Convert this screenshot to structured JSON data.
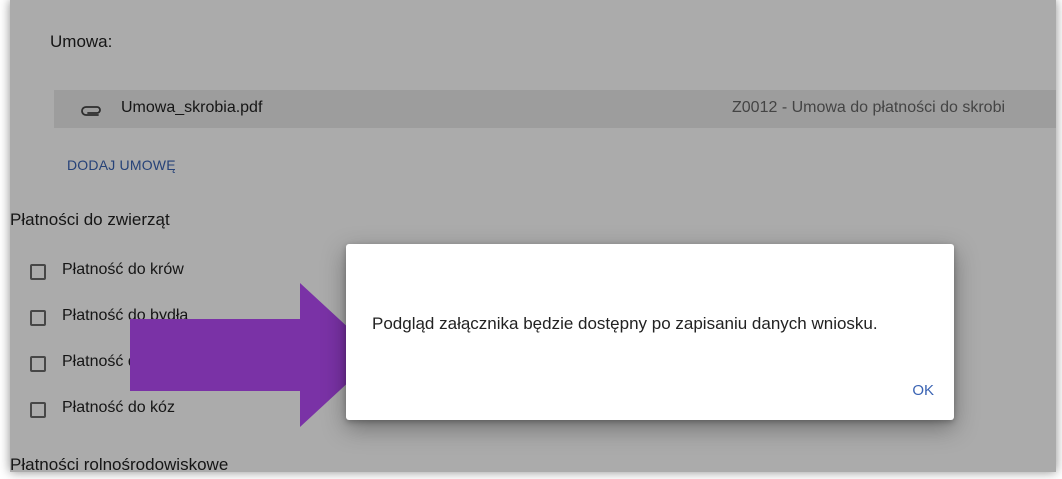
{
  "contract": {
    "label": "Umowa:",
    "attachment": {
      "file_name": "Umowa_skrobia.pdf",
      "type": "Z0012 - Umowa do płatności do skrobi",
      "icon": "paperclip-icon"
    },
    "add_button": "DODAJ UMOWĘ"
  },
  "animal_payments": {
    "title": "Płatności do zwierząt",
    "items": [
      {
        "label": "Płatność do krów",
        "checked": false
      },
      {
        "label": "Płatność do bydła",
        "checked": false
      },
      {
        "label": "Płatność do owiec",
        "checked": false
      },
      {
        "label": "Płatność do kóz",
        "checked": false
      }
    ]
  },
  "agri_env_payments": {
    "title": "Płatności rolnośrodowiskowe"
  },
  "dialog": {
    "message": "Podgląd załącznika będzie dostępny po zapisaniu danych wniosku.",
    "ok_label": "OK"
  },
  "colors": {
    "link": "#3a63b3",
    "arrow": "#7a32a6",
    "overlay": "rgba(0,0,0,0.33)"
  }
}
